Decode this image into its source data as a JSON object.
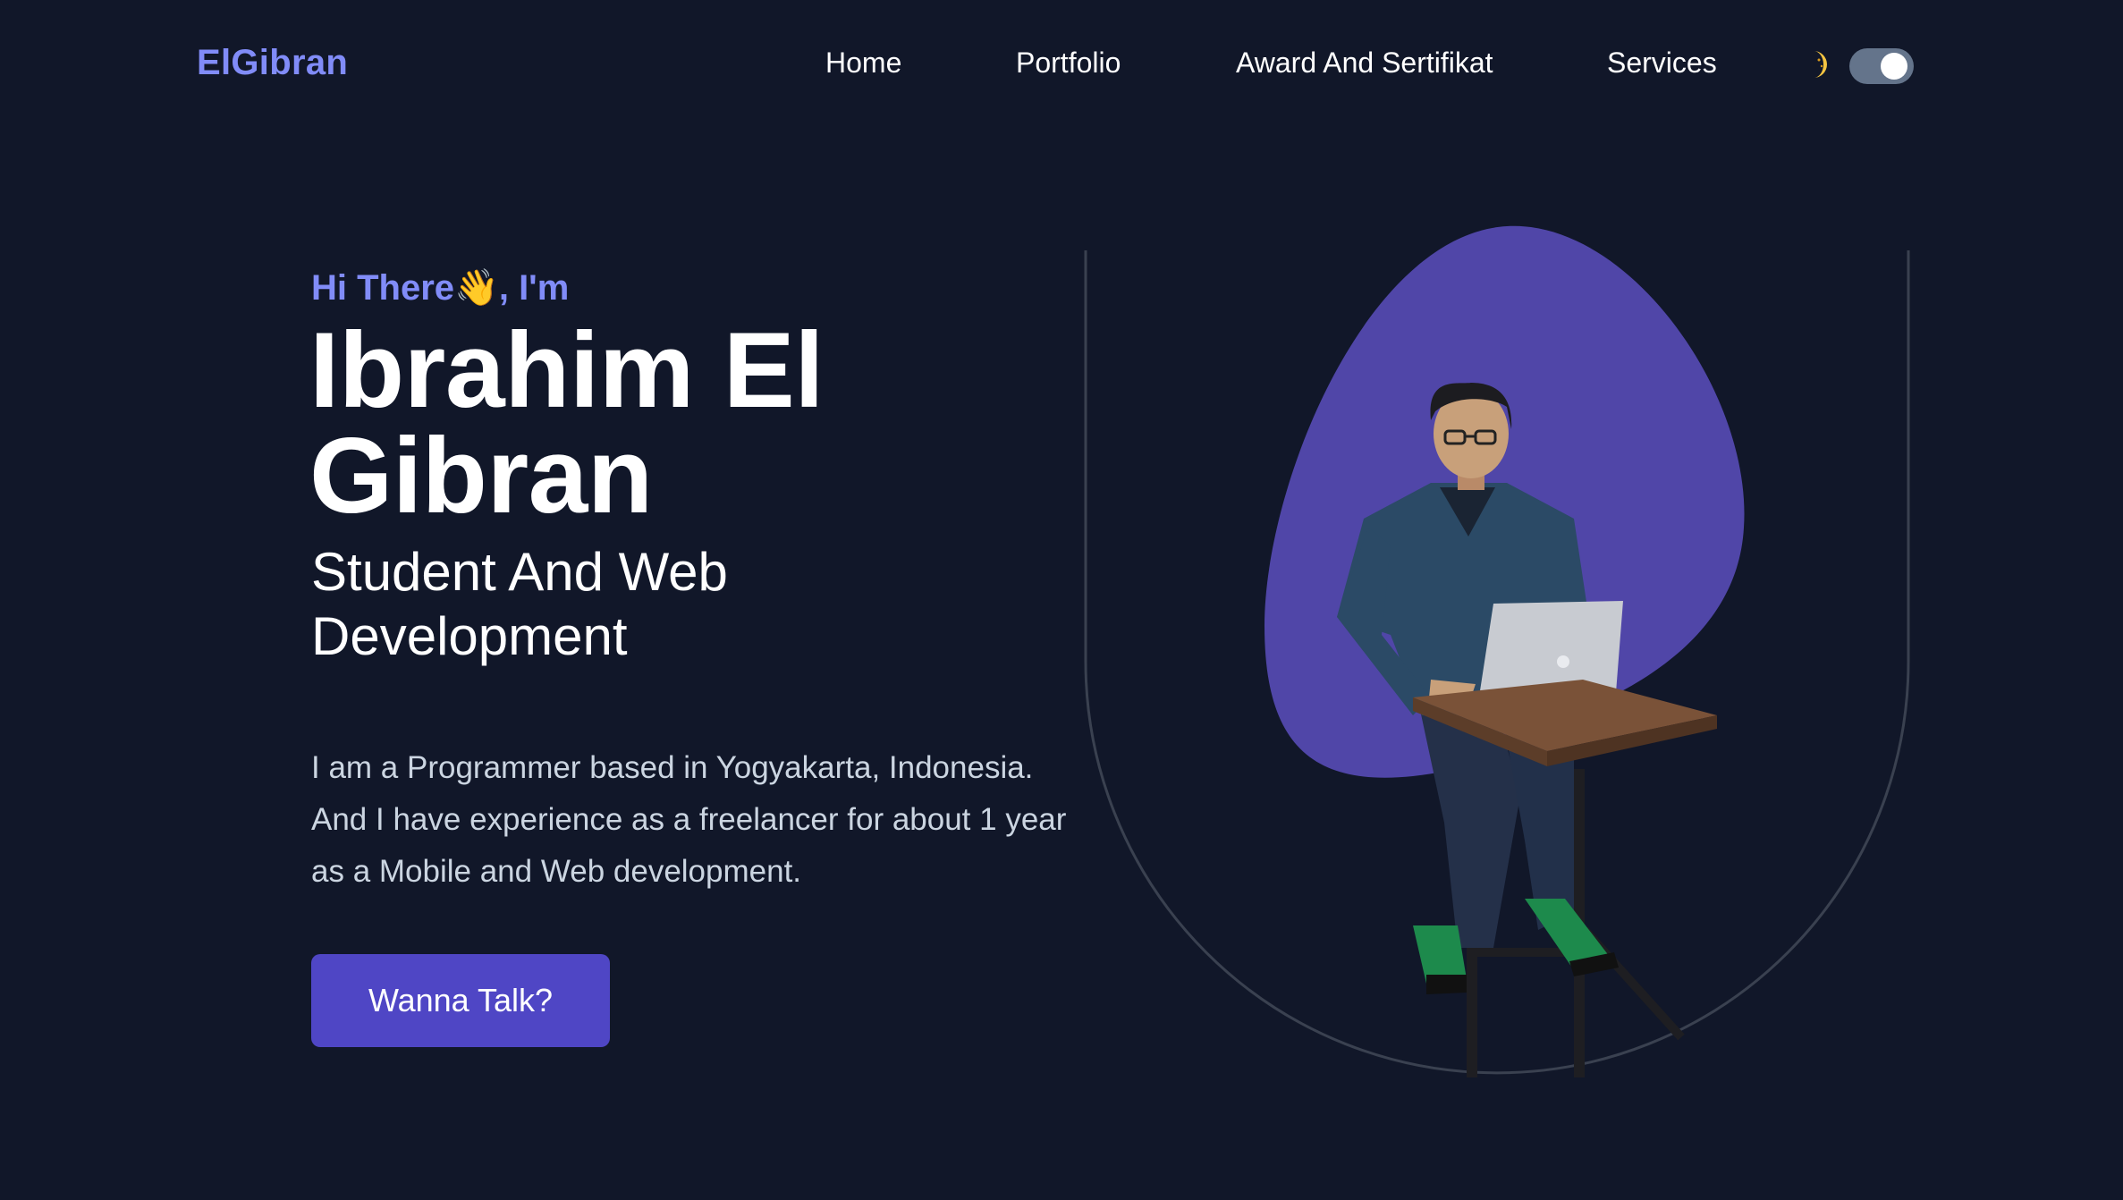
{
  "nav": {
    "brand": "ElGibran",
    "links": [
      {
        "label": "Home"
      },
      {
        "label": "Portfolio"
      },
      {
        "label": "Award And Sertifikat"
      },
      {
        "label": "Services"
      }
    ],
    "theme_toggle": {
      "icon": "moon-icon",
      "state": "on"
    }
  },
  "hero": {
    "greeting": "Hi There👋, I'm",
    "name": "Ibrahim El Gibran",
    "role": "Student And Web Development",
    "bio": "I am a Programmer based in Yogyakarta, Indonesia. And I have experience as a freelancer for about 1 year as a Mobile and Web development.",
    "cta_label": "Wanna Talk?",
    "image_icon": "person-with-laptop-illustration"
  },
  "colors": {
    "background": "#111729",
    "accent": "#818cf8",
    "button": "#4f46c5",
    "blob": "#5046a8",
    "arch_outline": "#3a4150"
  }
}
